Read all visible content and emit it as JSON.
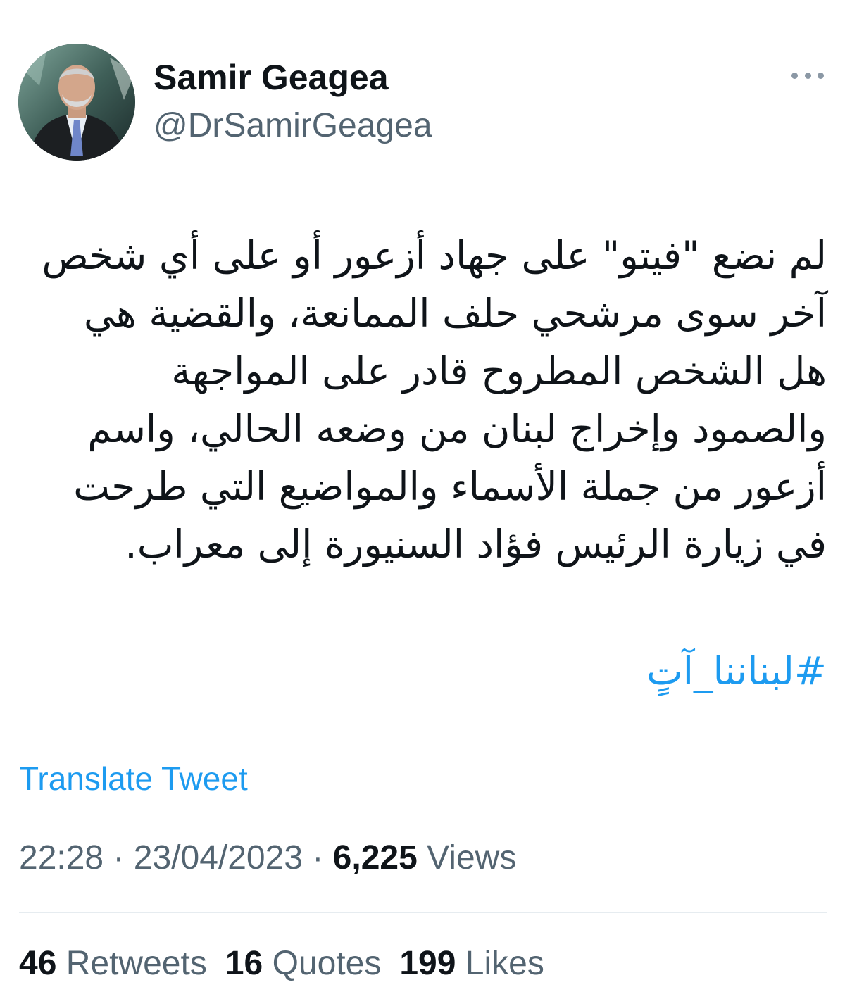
{
  "author": {
    "display_name": "Samir Geagea",
    "handle": "@DrSamirGeagea"
  },
  "tweet": {
    "text": "لم نضع \"فيتو\" على جهاد أزعور أو على أي شخص\nآخر سوى مرشحي حلف الممانعة، والقضية هي\nهل الشخص المطروح قادر على المواجهة\nوالصمود وإخراج لبنان من وضعه الحالي، واسم\nأزعور من جملة الأسماء والمواضيع التي طرحت\nفي زيارة الرئيس فؤاد السنيورة إلى معراب.",
    "hashtag": "#لبناننا_آتٍ",
    "translate_label": "Translate Tweet"
  },
  "meta": {
    "time": "22:28",
    "separator": " · ",
    "date": "23/04/2023",
    "views_count": "6,225",
    "views_label": "Views"
  },
  "stats": {
    "retweets_count": "46",
    "retweets_label": "Retweets",
    "quotes_count": "16",
    "quotes_label": "Quotes",
    "likes_count": "199",
    "likes_label": "Likes"
  },
  "icons": {
    "more": "more-options-icon",
    "avatar": "profile-photo"
  },
  "colors": {
    "link": "#1d9bf0",
    "secondary_text": "#536471",
    "primary_text": "#0f1419"
  }
}
